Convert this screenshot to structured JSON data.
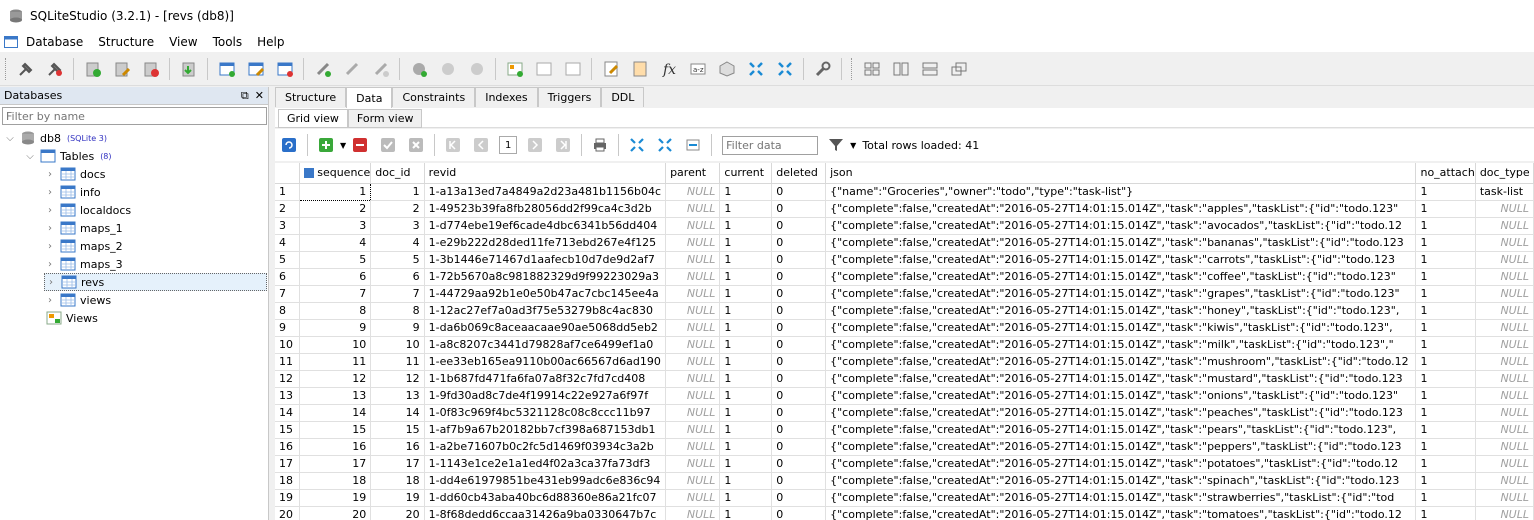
{
  "window": {
    "title": "SQLiteStudio (3.2.1) - [revs (db8)]"
  },
  "menu": [
    "Database",
    "Structure",
    "View",
    "Tools",
    "Help"
  ],
  "databases_panel": {
    "title": "Databases",
    "filter_placeholder": "Filter by name",
    "db_name": "db8",
    "db_version": "(SQLite 3)",
    "tables_label": "Tables",
    "tables_count": "(8)",
    "tables": [
      "docs",
      "info",
      "localdocs",
      "maps_1",
      "maps_2",
      "maps_3",
      "revs",
      "views"
    ],
    "selected_table": "revs",
    "views_label": "Views"
  },
  "tabs": [
    "Structure",
    "Data",
    "Constraints",
    "Indexes",
    "Triggers",
    "DDL"
  ],
  "active_tab": "Data",
  "subtabs": [
    "Grid view",
    "Form view"
  ],
  "active_subtab": "Grid view",
  "grid_toolbar": {
    "page": "1",
    "filter_placeholder": "Filter data",
    "rows_loaded": "Total rows loaded: 41"
  },
  "columns": [
    "sequence",
    "doc_id",
    "revid",
    "parent",
    "current",
    "deleted",
    "json",
    "no_attach",
    "doc_type"
  ],
  "rows": [
    [
      "1",
      "1",
      "1-a13a13ed7a4849a2d23a481b1156b04c",
      "NULL",
      "1",
      "0",
      "{\"name\":\"Groceries\",\"owner\":\"todo\",\"type\":\"task-list\"}",
      "1",
      "task-list"
    ],
    [
      "2",
      "2",
      "1-49523b39fa8fb28056dd2f99ca4c3d2b",
      "NULL",
      "1",
      "0",
      "{\"complete\":false,\"createdAt\":\"2016-05-27T14:01:15.014Z\",\"task\":\"apples\",\"taskList\":{\"id\":\"todo.123\"",
      "1",
      "NULL"
    ],
    [
      "3",
      "3",
      "1-d774ebe19ef6cade4dbc6341b56dd404",
      "NULL",
      "1",
      "0",
      "{\"complete\":false,\"createdAt\":\"2016-05-27T14:01:15.014Z\",\"task\":\"avocados\",\"taskList\":{\"id\":\"todo.12",
      "1",
      "NULL"
    ],
    [
      "4",
      "4",
      "1-e29b222d28ded11fe713ebd267e4f125",
      "NULL",
      "1",
      "0",
      "{\"complete\":false,\"createdAt\":\"2016-05-27T14:01:15.014Z\",\"task\":\"bananas\",\"taskList\":{\"id\":\"todo.123",
      "1",
      "NULL"
    ],
    [
      "5",
      "5",
      "1-3b1446e71467d1aafecb10d7de9d2af7",
      "NULL",
      "1",
      "0",
      "{\"complete\":false,\"createdAt\":\"2016-05-27T14:01:15.014Z\",\"task\":\"carrots\",\"taskList\":{\"id\":\"todo.123",
      "1",
      "NULL"
    ],
    [
      "6",
      "6",
      "1-72b5670a8c981882329d9f99223029a3",
      "NULL",
      "1",
      "0",
      "{\"complete\":false,\"createdAt\":\"2016-05-27T14:01:15.014Z\",\"task\":\"coffee\",\"taskList\":{\"id\":\"todo.123\"",
      "1",
      "NULL"
    ],
    [
      "7",
      "7",
      "1-44729aa92b1e0e50b47ac7cbc145ee4a",
      "NULL",
      "1",
      "0",
      "{\"complete\":false,\"createdAt\":\"2016-05-27T14:01:15.014Z\",\"task\":\"grapes\",\"taskList\":{\"id\":\"todo.123\"",
      "1",
      "NULL"
    ],
    [
      "8",
      "8",
      "1-12ac27ef7a0ad3f75e53279b8c4ac830",
      "NULL",
      "1",
      "0",
      "{\"complete\":false,\"createdAt\":\"2016-05-27T14:01:15.014Z\",\"task\":\"honey\",\"taskList\":{\"id\":\"todo.123\",",
      "1",
      "NULL"
    ],
    [
      "9",
      "9",
      "1-da6b069c8aceaacaae90ae5068dd5eb2",
      "NULL",
      "1",
      "0",
      "{\"complete\":false,\"createdAt\":\"2016-05-27T14:01:15.014Z\",\"task\":\"kiwis\",\"taskList\":{\"id\":\"todo.123\",",
      "1",
      "NULL"
    ],
    [
      "10",
      "10",
      "1-a8c8207c3441d79828af7ce6499ef1a0",
      "NULL",
      "1",
      "0",
      "{\"complete\":false,\"createdAt\":\"2016-05-27T14:01:15.014Z\",\"task\":\"milk\",\"taskList\":{\"id\":\"todo.123\",\"",
      "1",
      "NULL"
    ],
    [
      "11",
      "11",
      "1-ee33eb165ea9110b00ac66567d6ad190",
      "NULL",
      "1",
      "0",
      "{\"complete\":false,\"createdAt\":\"2016-05-27T14:01:15.014Z\",\"task\":\"mushroom\",\"taskList\":{\"id\":\"todo.12",
      "1",
      "NULL"
    ],
    [
      "12",
      "12",
      "1-1b687fd471fa6fa07a8f32c7fd7cd408",
      "NULL",
      "1",
      "0",
      "{\"complete\":false,\"createdAt\":\"2016-05-27T14:01:15.014Z\",\"task\":\"mustard\",\"taskList\":{\"id\":\"todo.123",
      "1",
      "NULL"
    ],
    [
      "13",
      "13",
      "1-9fd30ad8c7de4f19914c22e927a6f97f",
      "NULL",
      "1",
      "0",
      "{\"complete\":false,\"createdAt\":\"2016-05-27T14:01:15.014Z\",\"task\":\"onions\",\"taskList\":{\"id\":\"todo.123\"",
      "1",
      "NULL"
    ],
    [
      "14",
      "14",
      "1-0f83c969f4bc5321128c08c8ccc11b97",
      "NULL",
      "1",
      "0",
      "{\"complete\":false,\"createdAt\":\"2016-05-27T14:01:15.014Z\",\"task\":\"peaches\",\"taskList\":{\"id\":\"todo.123",
      "1",
      "NULL"
    ],
    [
      "15",
      "15",
      "1-af7b9a67b20182bb7cf398a687153db1",
      "NULL",
      "1",
      "0",
      "{\"complete\":false,\"createdAt\":\"2016-05-27T14:01:15.014Z\",\"task\":\"pears\",\"taskList\":{\"id\":\"todo.123\",",
      "1",
      "NULL"
    ],
    [
      "16",
      "16",
      "1-a2be71607b0c2fc5d1469f03934c3a2b",
      "NULL",
      "1",
      "0",
      "{\"complete\":false,\"createdAt\":\"2016-05-27T14:01:15.014Z\",\"task\":\"peppers\",\"taskList\":{\"id\":\"todo.123",
      "1",
      "NULL"
    ],
    [
      "17",
      "17",
      "1-1143e1ce2e1a1ed4f02a3ca37fa73df3",
      "NULL",
      "1",
      "0",
      "{\"complete\":false,\"createdAt\":\"2016-05-27T14:01:15.014Z\",\"task\":\"potatoes\",\"taskList\":{\"id\":\"todo.12",
      "1",
      "NULL"
    ],
    [
      "18",
      "18",
      "1-dd4e61979851be431eb99adc6e836c94",
      "NULL",
      "1",
      "0",
      "{\"complete\":false,\"createdAt\":\"2016-05-27T14:01:15.014Z\",\"task\":\"spinach\",\"taskList\":{\"id\":\"todo.123",
      "1",
      "NULL"
    ],
    [
      "19",
      "19",
      "1-dd60cb43aba40bc6d88360e86a21fc07",
      "NULL",
      "1",
      "0",
      "{\"complete\":false,\"createdAt\":\"2016-05-27T14:01:15.014Z\",\"task\":\"strawberries\",\"taskList\":{\"id\":\"tod",
      "1",
      "NULL"
    ],
    [
      "20",
      "20",
      "1-8f68dedd6ccaa31426a9ba0330647b7c",
      "NULL",
      "1",
      "0",
      "{\"complete\":false,\"createdAt\":\"2016-05-27T14:01:15.014Z\",\"task\":\"tomatoes\",\"taskList\":{\"id\":\"todo.12",
      "1",
      "NULL"
    ]
  ]
}
